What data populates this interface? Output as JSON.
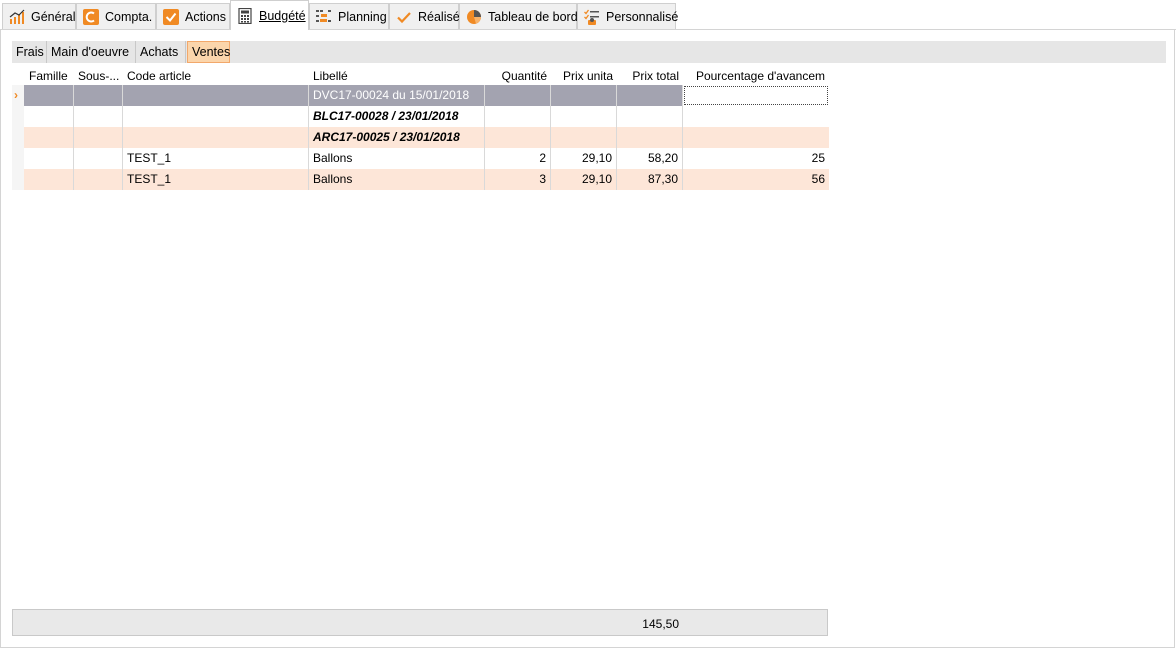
{
  "tabs": [
    {
      "label": "Général",
      "icon": "chart-line-icon"
    },
    {
      "label": "Compta.",
      "icon": "compta-icon"
    },
    {
      "label": "Actions",
      "icon": "checkbox-icon"
    },
    {
      "label": "Budgété",
      "icon": "calculator-icon"
    },
    {
      "label": "Planning",
      "icon": "planning-icon"
    },
    {
      "label": "Réalisé",
      "icon": "checkmark-icon"
    },
    {
      "label": "Tableau de bord",
      "icon": "pie-chart-icon"
    },
    {
      "label": "Personnalisé",
      "icon": "custom-icon"
    }
  ],
  "subtabs": [
    "Frais",
    "Main d'oeuvre",
    "Achats",
    "Ventes"
  ],
  "active_subtab": "Ventes",
  "grid": {
    "columns": [
      "Famille",
      "Sous-...",
      "Code article",
      "Libellé",
      "Quantité",
      "Prix unita",
      "Prix total",
      "Pourcentage d'avancem"
    ],
    "row_indicator": "›",
    "rows": [
      {
        "famille": "",
        "sous": "",
        "code": "",
        "libelle": "DVC17-00024 du 15/01/2018",
        "quantite": "",
        "prix_unit": "",
        "prix_total": "",
        "pourcentage": ""
      },
      {
        "famille": "",
        "sous": "",
        "code": "",
        "libelle": "BLC17-00028 / 23/01/2018",
        "quantite": "",
        "prix_unit": "",
        "prix_total": "",
        "pourcentage": ""
      },
      {
        "famille": "",
        "sous": "",
        "code": "",
        "libelle": "ARC17-00025 / 23/01/2018",
        "quantite": "",
        "prix_unit": "",
        "prix_total": "",
        "pourcentage": ""
      },
      {
        "famille": "",
        "sous": "",
        "code": "TEST_1",
        "libelle": "Ballons",
        "quantite": "2",
        "prix_unit": "29,10",
        "prix_total": "58,20",
        "pourcentage": "25"
      },
      {
        "famille": "",
        "sous": "",
        "code": "TEST_1",
        "libelle": "Ballons",
        "quantite": "3",
        "prix_unit": "29,10",
        "prix_total": "87,30",
        "pourcentage": "56"
      }
    ]
  },
  "footer": {
    "total": "145,50"
  },
  "colors": {
    "accent": "#f08a24",
    "selected_row": "#a3a3b0",
    "alt_row": "#fde6d8",
    "active_subtab": "#fbd5ab"
  }
}
